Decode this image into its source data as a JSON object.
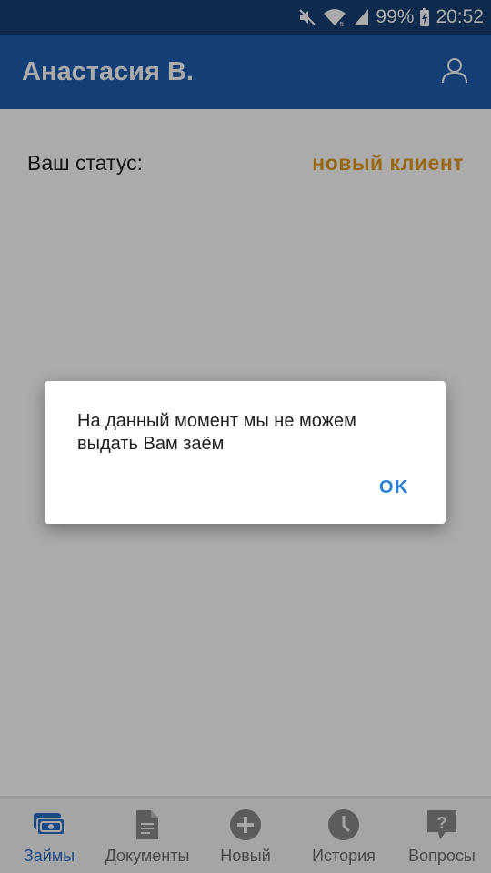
{
  "status_bar": {
    "battery": "99%",
    "time": "20:52",
    "icons": [
      "mute-icon",
      "wifi-icon",
      "signal-icon",
      "battery-charging-icon"
    ]
  },
  "app_bar": {
    "title": "Анастасия В.",
    "profile_icon": "user-icon"
  },
  "main": {
    "status_label": "Ваш статус:",
    "status_value": "новый клиент",
    "status_color": "#e39a1c"
  },
  "dialog": {
    "message": "На данный момент мы не можем выдать Вам заём",
    "ok_label": "OK"
  },
  "bottom_nav": {
    "active_color": "#2a6fc7",
    "items": [
      {
        "label": "Займы",
        "icon": "cash-icon",
        "active": true
      },
      {
        "label": "Документы",
        "icon": "document-icon",
        "active": false
      },
      {
        "label": "Новый",
        "icon": "plus-circle-icon",
        "active": false
      },
      {
        "label": "История",
        "icon": "clock-icon",
        "active": false
      },
      {
        "label": "Вопросы",
        "icon": "question-bubble-icon",
        "active": false
      }
    ]
  }
}
